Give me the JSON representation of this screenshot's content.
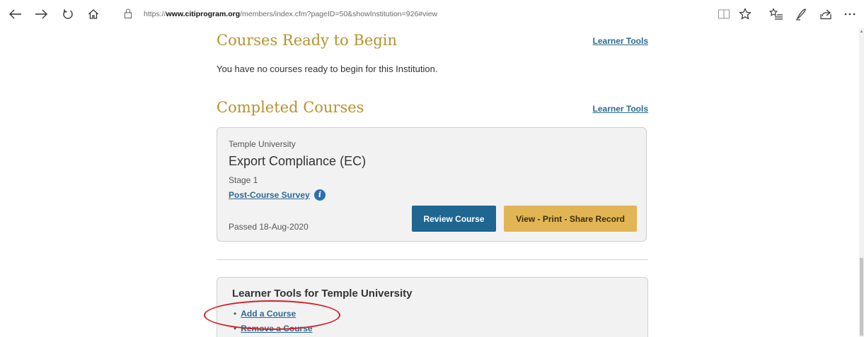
{
  "browser": {
    "url": {
      "scheme": "https://",
      "host": "www.citiprogram.org",
      "path": "/members/index.cfm?pageID=50&showInstitution=926#view"
    },
    "icons": {
      "back": "arrow-left-icon",
      "forward": "arrow-right-icon",
      "refresh": "refresh-icon",
      "home": "home-icon",
      "lock": "lock-icon",
      "reading_view": "book-icon",
      "favorite": "star-icon",
      "favorites_hub": "favorites-list-icon",
      "notes": "pen-icon",
      "share": "share-icon",
      "more": "more-icon"
    }
  },
  "sections": {
    "ready": {
      "title": "Courses Ready to Begin",
      "tools_link": "Learner Tools",
      "empty_message": "You have no courses ready to begin for this Institution."
    },
    "completed": {
      "title": "Completed Courses",
      "tools_link": "Learner Tools",
      "course": {
        "institution": "Temple University",
        "title": "Export Compliance (EC)",
        "stage": "Stage 1",
        "survey_link": "Post-Course Survey",
        "status": "Passed 18-Aug-2020",
        "review_button": "Review Course",
        "record_button": "View - Print - Share Record"
      }
    }
  },
  "learner_tools": {
    "heading": "Learner Tools for Temple University",
    "items": [
      {
        "label": "Add a Course"
      },
      {
        "label": "Remove a Course"
      }
    ]
  },
  "colors": {
    "section_title": "#b6922f",
    "link": "#2c6a94",
    "review_button": "#1f6691",
    "record_button": "#e2b554",
    "annotation": "#d81f26"
  }
}
